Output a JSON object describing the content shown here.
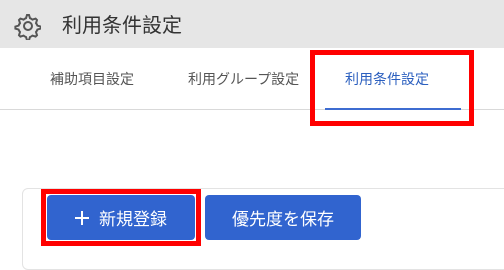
{
  "header": {
    "icon": "gear-icon",
    "title": "利用条件設定"
  },
  "tabs": [
    {
      "label": "補助項目設定",
      "active": false
    },
    {
      "label": "利用グループ設定",
      "active": false
    },
    {
      "label": "利用条件設定",
      "active": true
    }
  ],
  "actions": {
    "new_icon": "plus-icon",
    "new_label": "新規登録",
    "save_priority_label": "優先度を保存"
  },
  "colors": {
    "header_bg": "#e6e6e6",
    "accent": "#3164cf",
    "active_tab_text": "#2b5fbf",
    "highlight": "#ff0000"
  }
}
